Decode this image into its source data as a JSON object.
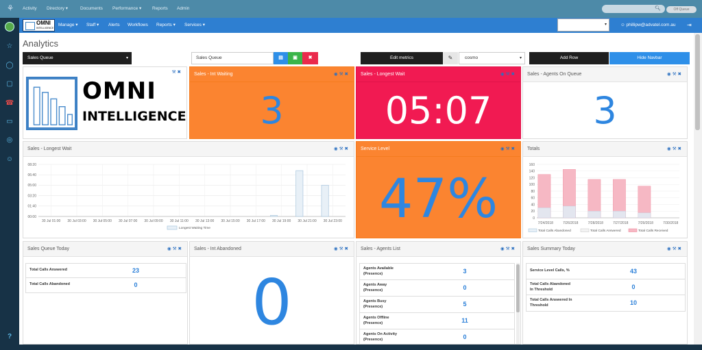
{
  "topbar": {
    "nav": [
      "Activity",
      "Directory ▾",
      "Documents",
      "Performance ▾",
      "Reports",
      "Admin"
    ],
    "status": "Off Queue"
  },
  "nav2": {
    "brand_title": "OMNI",
    "brand_sub": "INTELLIGENCE",
    "items": [
      "Manage ▾",
      "Staff ▾",
      "Alerts",
      "Workflows",
      "Reports ▾",
      "Services ▾"
    ],
    "user": "phillipw@advatel.com.au"
  },
  "page": {
    "title": "Analytics"
  },
  "toolbar": {
    "queue_select": "Sales Queue",
    "dashboard_name": "Sales Queue",
    "edit_metrics": "Edit metrics",
    "theme": "cosmo",
    "add_row": "Add Row",
    "hide_navbar": "Hide Navbar"
  },
  "widgets": {
    "logo": {
      "title": "OMNI",
      "subtitle": "INTELLIGENCE"
    },
    "int_waiting": {
      "title": "Sales - Int Waiting",
      "value": "3"
    },
    "longest_wait": {
      "title": "Sales - Longest Wait",
      "value": "05:07"
    },
    "agents_on_queue": {
      "title": "Sales - Agents On Queue",
      "value": "3"
    },
    "longest_wait_chart": {
      "title": "Sales - Longest Wait"
    },
    "service_level": {
      "title": "Service Level",
      "value": "47%"
    },
    "totals": {
      "title": "Totals"
    },
    "queue_today": {
      "title": "Sales Queue Today",
      "rows": [
        {
          "label": "Total Calls Answered",
          "value": "23"
        },
        {
          "label": "Total Calls Abandoned",
          "value": "0"
        }
      ]
    },
    "int_abandoned": {
      "title": "Sales - Int Abandoned",
      "value": "0"
    },
    "agents_list": {
      "title": "Sales - Agents List",
      "rows": [
        {
          "label": "Agents Available",
          "sub": "(Presence)",
          "value": "3"
        },
        {
          "label": "Agents Away",
          "sub": "(Presence)",
          "value": "0"
        },
        {
          "label": "Agents Busy",
          "sub": "(Presence)",
          "value": "5"
        },
        {
          "label": "Agents Offline",
          "sub": "(Presence)",
          "value": "11"
        },
        {
          "label": "Agents On Activity",
          "sub": "(Presence)",
          "value": "0"
        }
      ]
    },
    "summary_today": {
      "title": "Sales Summary Today",
      "rows": [
        {
          "label": "Service Level Calls, %",
          "sub": "",
          "value": "43"
        },
        {
          "label": "Total Calls Abandoned",
          "sub": "In Threshold",
          "value": "0"
        },
        {
          "label": "Total Calls Answered In",
          "sub": "Threshold",
          "value": "10"
        }
      ]
    }
  },
  "colors": {
    "orange": "#fb8430",
    "red": "#f11a52",
    "accent_blue": "#2e7fd1",
    "number_blue": "#2a7fd8"
  },
  "chart_data": [
    {
      "type": "bar",
      "title": "Sales - Longest Wait",
      "x": [
        "30 Jul 01:00",
        "30 Jul 03:00",
        "30 Jul 05:00",
        "30 Jul 07:00",
        "30 Jul 09:00",
        "30 Jul 11:00",
        "30 Jul 13:00",
        "30 Jul 15:00",
        "30 Jul 17:00",
        "30 Jul 19:00",
        "30 Jul 21:00",
        "30 Jul 23:00"
      ],
      "y_ticks": [
        "00:00",
        "01:40",
        "03:20",
        "05:00",
        "06:40",
        "08:20"
      ],
      "ylim": [
        0,
        500
      ],
      "series": [
        {
          "name": "Longest Waiting Time",
          "bars": [
            {
              "x": 8.7,
              "value": 10
            },
            {
              "x": 9.7,
              "value": 440
            },
            {
              "x": 10.7,
              "value": 300
            }
          ]
        }
      ],
      "legend": "bottom"
    },
    {
      "type": "bar",
      "title": "Totals",
      "x": [
        "7/24/2018",
        "7/26/2018",
        "7/28/2018",
        "7/27/2018",
        "7/29/2018",
        "7/30/2018"
      ],
      "y_ticks": [
        0,
        20,
        40,
        60,
        80,
        100,
        120,
        140,
        160
      ],
      "ylim": [
        0,
        160
      ],
      "series": [
        {
          "name": "Total Calls Abandoned",
          "values": [
            0,
            0,
            0,
            0,
            0,
            0
          ]
        },
        {
          "name": "Total Calls Answered",
          "values": [
            30,
            35,
            20,
            20,
            15,
            0
          ]
        },
        {
          "name": "Total Calls Received",
          "values": [
            130,
            145,
            115,
            115,
            95,
            0
          ]
        }
      ],
      "legend": "bottom"
    }
  ]
}
